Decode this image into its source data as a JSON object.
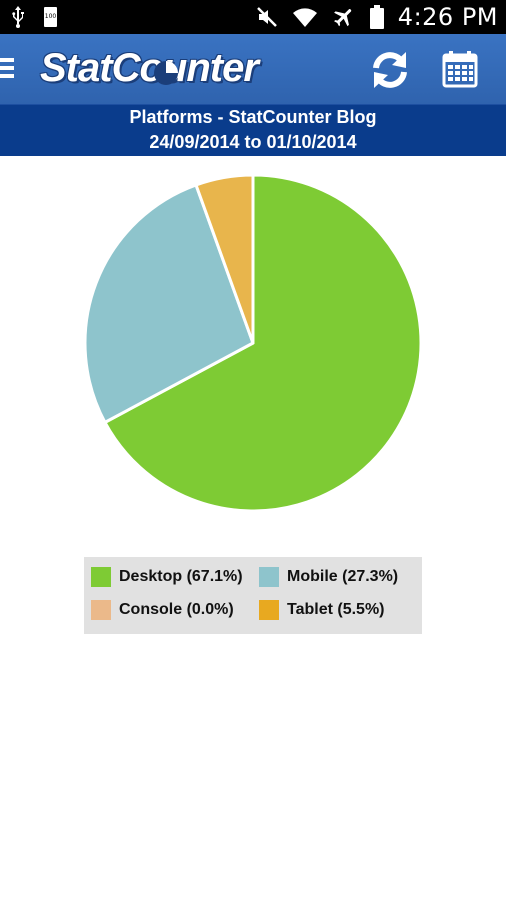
{
  "status_bar": {
    "time": "4:26 PM",
    "battery_level": "100"
  },
  "app_bar": {
    "logo_text": "StatCounter",
    "icons": [
      "menu-icon",
      "refresh-icon",
      "calendar-icon"
    ]
  },
  "header": {
    "title": "Platforms - StatCounter Blog",
    "date_range": "24/09/2014 to 01/10/2014"
  },
  "colors": {
    "desktop": "#7ecb34",
    "mobile": "#8ec4cc",
    "console": "#ebb98a",
    "tablet": "#e8b54c"
  },
  "legend": {
    "items": [
      {
        "label": "Desktop (67.1%)",
        "color": "#7ecb34"
      },
      {
        "label": "Mobile (27.3%)",
        "color": "#8ec4cc"
      },
      {
        "label": "Console (0.0%)",
        "color": "#ebb98a"
      },
      {
        "label": "Tablet (5.5%)",
        "color": "#e8a920"
      }
    ]
  },
  "chart_data": {
    "type": "pie",
    "categories": [
      "Desktop",
      "Mobile",
      "Console",
      "Tablet"
    ],
    "values": [
      67.1,
      27.3,
      0.0,
      5.5
    ],
    "colors": [
      "#7ecb34",
      "#8ec4cc",
      "#ebb98a",
      "#e8b54c"
    ],
    "title": "Platforms - StatCounter Blog",
    "subtitle": "24/09/2014 to 01/10/2014",
    "legend_placement": "bottom"
  }
}
